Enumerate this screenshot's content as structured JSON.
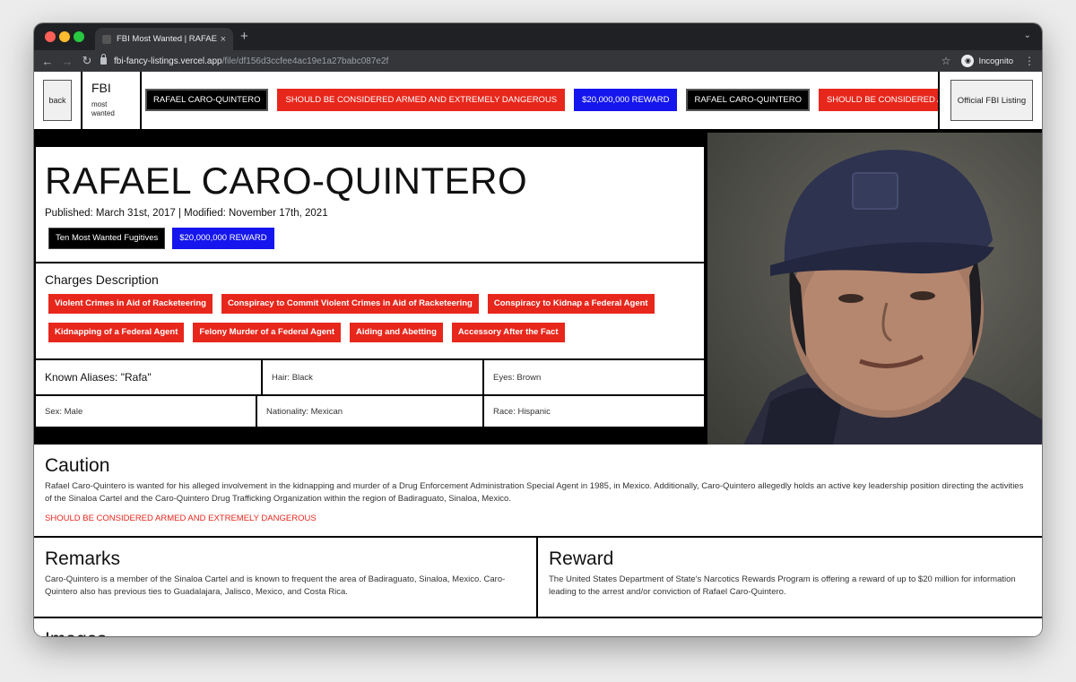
{
  "browser": {
    "tab_title": "FBI Most Wanted | RAFAEL CA",
    "tab_close": "×",
    "new_tab": "+",
    "url_domain": "fbi-fancy-listings.vercel.app",
    "url_path": "/file/df156d3ccfee4ac19e1a27babc087e2f",
    "profile_label": "Incognito"
  },
  "header": {
    "back_label": "back",
    "brand_title": "FBI",
    "brand_subtitle": "most wanted",
    "official_label": "Official FBI Listing",
    "ticker": [
      {
        "text": "RAFAEL CARO-QUINTERO",
        "style": "black"
      },
      {
        "text": "SHOULD BE CONSIDERED ARMED AND EXTREMELY DANGEROUS",
        "style": "red"
      },
      {
        "text": "$20,000,000 REWARD",
        "style": "blue"
      },
      {
        "text": "RAFAEL CARO-QUINTERO",
        "style": "black"
      },
      {
        "text": "SHOULD BE CONSIDERED ARMED AND EXTREMELY DANGEROUS",
        "style": "red"
      }
    ]
  },
  "profile": {
    "name": "RAFAEL CARO-QUINTERO",
    "published": "Published: March 31st, 2017 | Modified: November 17th, 2021",
    "tags": [
      "Ten Most Wanted Fugitives",
      "$20,000,000 REWARD"
    ],
    "charges_title": "Charges Description",
    "charges": [
      "Violent Crimes in Aid of Racketeering",
      "Conspiracy to Commit Violent Crimes in Aid of Racketeering",
      "Conspiracy to Kidnap a Federal Agent",
      "Kidnapping of a Federal Agent",
      "Felony Murder of a Federal Agent",
      "Aiding and Abetting",
      "Accessory After the Fact"
    ],
    "aliases": "Known Aliases: \"Rafa\"",
    "hair": "Hair: Black",
    "eyes": "Eyes: Brown",
    "sex": "Sex: Male",
    "nationality": "Nationality: Mexican",
    "race": "Race: Hispanic"
  },
  "caution": {
    "title": "Caution",
    "text": "Rafael Caro-Quintero is wanted for his alleged involvement in the kidnapping and murder of a Drug Enforcement Administration Special Agent in 1985, in Mexico. Additionally, Caro-Quintero allegedly holds an active key leadership position directing the activities of the Sinaloa Cartel and the Caro-Quintero Drug Trafficking Organization within the region of Badiraguato, Sinaloa, Mexico.",
    "warning": "SHOULD BE CONSIDERED ARMED AND EXTREMELY DANGEROUS"
  },
  "remarks": {
    "title": "Remarks",
    "text": "Caro-Quintero is a member of the Sinaloa Cartel and is known to frequent the area of Badiraguato, Sinaloa, Mexico. Caro-Quintero also has previous ties to Guadalajara, Jalisco, Mexico, and Costa Rica."
  },
  "reward": {
    "title": "Reward",
    "text": "The United States Department of State's Narcotics Rewards Program is offering a reward of up to $20 million for information leading to the arrest and/or conviction of Rafael Caro-Quintero."
  },
  "images": {
    "title": "Images"
  },
  "colors": {
    "red": "#e8271c",
    "blue": "#1515ee",
    "black": "#000000"
  }
}
